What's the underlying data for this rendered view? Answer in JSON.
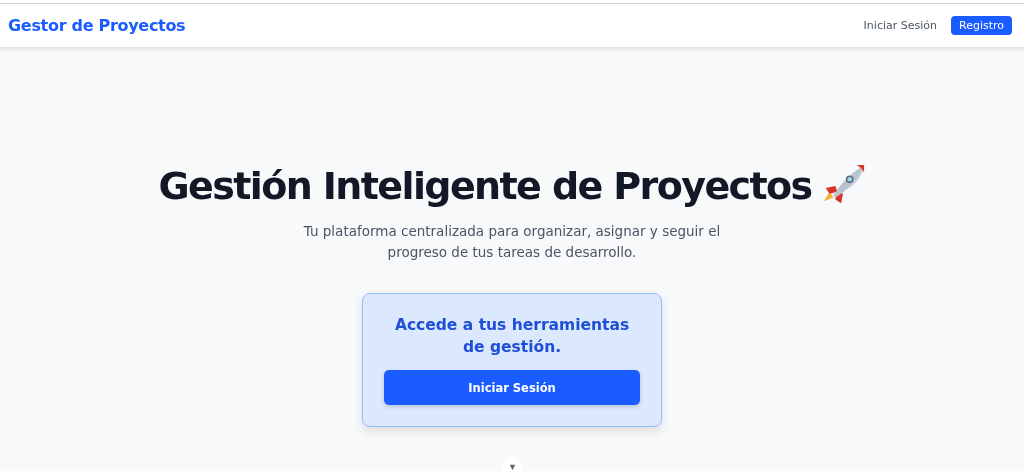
{
  "navbar": {
    "brand": "Gestor de Proyectos",
    "links": [
      {
        "label": "Iniciar Sesión",
        "kind": "link"
      },
      {
        "label": "Registro",
        "kind": "button"
      }
    ]
  },
  "hero": {
    "title": "Gestión Inteligente de Proyectos",
    "subtitle": "Tu plataforma centralizada para organizar, asignar y seguir el progreso de tus tareas de desarrollo."
  },
  "card": {
    "heading": "Accede a tus herramientas de gestión.",
    "button": "Iniciar Sesión"
  }
}
